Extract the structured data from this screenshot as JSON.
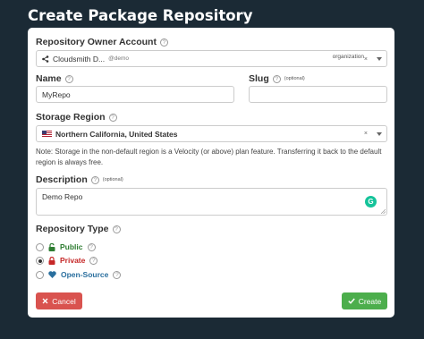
{
  "header": {
    "title": "Create Package Repository"
  },
  "owner": {
    "label": "Repository Owner Account",
    "name": "Cloudsmith D...",
    "handle": "@demo",
    "type": "organization"
  },
  "name": {
    "label": "Name",
    "value": "MyRepo"
  },
  "slug": {
    "label": "Slug",
    "optional": "(optional)",
    "value": ""
  },
  "region": {
    "label": "Storage Region",
    "value": "Northern California, United States",
    "note": "Note: Storage in the non-default region is a Velocity (or above) plan feature. Transferring it back to the default region is always free."
  },
  "description": {
    "label": "Description",
    "optional": "(optional)",
    "value": "Demo Repo"
  },
  "type": {
    "label": "Repository Type",
    "options": [
      {
        "label": "Public",
        "color": "#2e7d32",
        "icon": "unlock-icon",
        "checked": false
      },
      {
        "label": "Private",
        "color": "#c62828",
        "icon": "lock-icon",
        "checked": true
      },
      {
        "label": "Open-Source",
        "color": "#2a6f9e",
        "icon": "heart-icon",
        "checked": false
      }
    ]
  },
  "buttons": {
    "cancel": "Cancel",
    "create": "Create"
  },
  "colors": {
    "cancel": "#d9534f",
    "create": "#4cae4c",
    "grammarly": "#15c39a"
  }
}
